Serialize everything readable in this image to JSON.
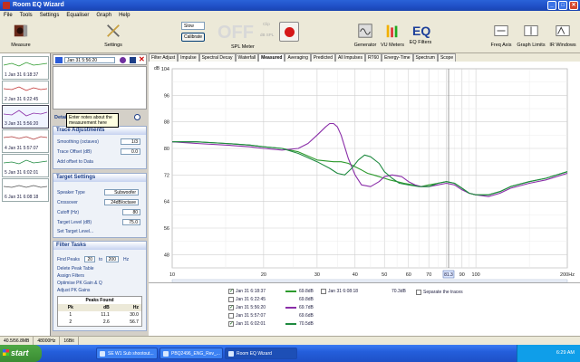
{
  "window": {
    "title": "Room EQ Wizard",
    "min": "_",
    "max": "□",
    "close": "✕"
  },
  "menu": [
    "File",
    "Tools",
    "Settings",
    "Equaliser",
    "Graph",
    "Help"
  ],
  "toolbar": {
    "measure": "Measure",
    "settings": "Settings",
    "slow": "Slow",
    "calibrate": "Calibrate",
    "off": "OFF",
    "clip": "Clip",
    "db_spl": "dB SPL",
    "spl_meter": "SPL Meter",
    "generator": "Generator",
    "vu_meters": "VU Meters",
    "eq_filters": "EQ Filters",
    "freq_axis": "Freq Axis",
    "graph_limits": "Graph Limits",
    "ir_windows": "IR Windows"
  },
  "measurements": [
    {
      "label": "1 Jan 31 6:18:37",
      "color": "#2c9a2c"
    },
    {
      "label": "2 Jan 31 6:22:45",
      "color": "#c03030"
    },
    {
      "label": "3 Jan 31 5:56:20",
      "color": "#8a2ea8"
    },
    {
      "label": "4 Jan 31 5:57:07",
      "color": "#b03a3a"
    },
    {
      "label": "5 Jan 31 6:02:01",
      "color": "#1f8a40"
    },
    {
      "label": "6 Jan 31 6:08:18",
      "color": "#555555"
    }
  ],
  "selected": {
    "name": "Jan 31 5:56:20",
    "notes_tip": "Enter notes about the measurement here"
  },
  "details_label": "Detai",
  "trace": {
    "title": "Trace Adjustments",
    "smoothing_label": "Smoothing (octaves)",
    "smoothing": "1/3",
    "offset_label": "Trace Offset (dB)",
    "offset": "0.0",
    "add_offset": "Add offset to Data"
  },
  "target": {
    "title": "Target Settings",
    "speaker_label": "Speaker Type",
    "speaker": "Subwoofer",
    "crossover_label": "Crossover",
    "crossover": "24dB/octave",
    "cutoff_label": "Cutoff (Hz)",
    "cutoff": "80",
    "level_label": "Target Level (dB)",
    "level": "75.0",
    "set_level": "Set Target Level..."
  },
  "filter": {
    "title": "Filter Tasks",
    "find_peaks": "Find Peaks",
    "from": "20",
    "to_label": "to",
    "to": "200",
    "hz": "Hz",
    "delete": "Delete Peak Table",
    "assign": "Assign Filters",
    "optimise": "Optimise PK Gain & Q",
    "adjust": "Adjust PK Gains",
    "peaks_title": "Peaks Found",
    "cols": [
      "Pk",
      "dB",
      "Hz"
    ],
    "rows": [
      [
        "1",
        "11.1",
        "30.0"
      ],
      [
        "2",
        "2.6",
        "56.7"
      ]
    ]
  },
  "tabs": [
    "Filter Adjust",
    "Impulse",
    "Spectral Decay",
    "Waterfall",
    "Measured",
    "Averaging",
    "Predicted",
    "All Impulses",
    "RT60",
    "Energy-Time",
    "Spectrum",
    "Scope"
  ],
  "active_tab": "Measured",
  "chart_data": {
    "type": "line",
    "xscale": "log",
    "xlim": [
      10,
      200
    ],
    "ylim": [
      44,
      104
    ],
    "y_unit": "dB",
    "xticks": [
      "10",
      "20",
      "30",
      "40",
      "50",
      "60",
      "70",
      "80",
      "90",
      "100",
      "200Hz"
    ],
    "x_tick_values": [
      10,
      20,
      30,
      40,
      50,
      60,
      70,
      80,
      90,
      100,
      200
    ],
    "yticks": [
      "104",
      "96",
      "88",
      "80",
      "72",
      "64",
      "56",
      "48"
    ],
    "y_tick_values": [
      104,
      96,
      88,
      80,
      72,
      64,
      56,
      48
    ],
    "cursor_label": "81.3",
    "cursor_x": 81.3,
    "series": [
      {
        "name": "Jan 31 6:18:37",
        "color": "#2c9a2c",
        "x": [
          10,
          12,
          15,
          18,
          20,
          23,
          26,
          30,
          34,
          36,
          38,
          40,
          42,
          44,
          46,
          48,
          50,
          52,
          55,
          58,
          62,
          66,
          70,
          75,
          80,
          85,
          90,
          95,
          100,
          110,
          120,
          130,
          150,
          170,
          200
        ],
        "y": [
          82,
          82,
          81.5,
          81,
          80.5,
          80,
          79,
          76.5,
          76,
          76,
          75.5,
          74.5,
          73.5,
          72.5,
          72,
          71.5,
          71,
          70.5,
          70,
          69.5,
          69,
          68.5,
          69,
          69.5,
          70,
          69.5,
          68,
          66.5,
          66,
          66,
          67,
          68.5,
          70,
          71,
          73
        ]
      },
      {
        "name": "Jan 31 5:56:20",
        "color": "#8a2ea8",
        "x": [
          10,
          12,
          15,
          18,
          20,
          23,
          26,
          28,
          30,
          32,
          33,
          34,
          35,
          36,
          38,
          40,
          42,
          45,
          48,
          50,
          53,
          57,
          60,
          63,
          66,
          70,
          75,
          80,
          85,
          90,
          95,
          100,
          110,
          120,
          130,
          150,
          170,
          200
        ],
        "y": [
          82,
          81.5,
          81,
          80.5,
          80,
          79.5,
          80,
          81.5,
          84,
          86.5,
          87.5,
          87.5,
          86.5,
          84,
          77,
          72,
          69,
          68.5,
          70,
          71.5,
          72,
          71.5,
          70,
          69,
          68.5,
          68.5,
          69,
          69.5,
          69,
          67.5,
          66.5,
          66,
          65.5,
          66.5,
          68,
          69.5,
          70.5,
          72.5
        ]
      },
      {
        "name": "Jan 31 6:02:01",
        "color": "#1f8a40",
        "x": [
          10,
          12,
          15,
          18,
          20,
          23,
          26,
          30,
          33,
          35,
          37,
          39,
          41,
          43,
          45,
          48,
          50,
          53,
          56,
          60,
          65,
          70,
          75,
          80,
          85,
          90,
          95,
          100,
          110,
          120,
          130,
          150,
          170,
          200
        ],
        "y": [
          82,
          82,
          81.5,
          81,
          80.5,
          80,
          78.5,
          76,
          74,
          72.5,
          72,
          74,
          76.5,
          78,
          77.5,
          75.5,
          73,
          71,
          69.5,
          69,
          68.5,
          68.5,
          69.5,
          70,
          69.5,
          68,
          66.5,
          66,
          66,
          67,
          68.5,
          70,
          71,
          73
        ]
      }
    ]
  },
  "legend": [
    {
      "label": "Jan 31 6:18:37",
      "value": "69.8dB",
      "checked": true,
      "color": "#2c9a2c"
    },
    {
      "label": "Jan 31 6:22:45",
      "value": "69.8dB",
      "checked": false,
      "color": ""
    },
    {
      "label": "Jan 31 5:56:20",
      "value": "69.7dB",
      "checked": true,
      "color": "#8a2ea8"
    },
    {
      "label": "Jan 31 5:57:07",
      "value": "69.6dB",
      "checked": false,
      "color": ""
    },
    {
      "label": "Jan 31 6:02:01",
      "value": "70.5dB",
      "checked": true,
      "color": "#1f8a40"
    },
    {
      "label": "Jan 31 6:08:18",
      "value": "70.3dB",
      "checked": false,
      "color": ""
    }
  ],
  "separate_traces": "Separate the traces",
  "status": {
    "mem": "40.5/56.8MB",
    "rate": "48000Hz",
    "bits": "16Bit"
  },
  "taskbar": {
    "start": "start",
    "tasks": [
      "SE W1 Sub shootout...",
      "PBQ2496_ENG_Rev_...",
      "Room EQ Wizard"
    ],
    "time": "6:29 AM"
  }
}
